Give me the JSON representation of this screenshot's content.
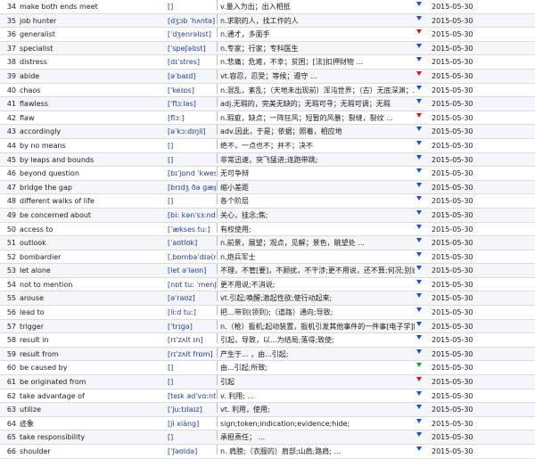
{
  "colors": {
    "flag_blue": "#1b4fd6",
    "flag_red": "#d11a1a",
    "flag_green": "#1d9a3a",
    "pron_text": "#1f3d9a"
  },
  "rows": [
    {
      "num": "34",
      "word": "make both ends meet",
      "pron": "[]",
      "def": "v.量入为出；出入相抵",
      "flag": "blue",
      "date": "2015-05-30"
    },
    {
      "num": "35",
      "word": "job hunter",
      "pron": "[dʒɔb ˈhʌntə]",
      "def": "n.求职的人，找工作的人",
      "flag": "blue",
      "date": "2015-05-30"
    },
    {
      "num": "36",
      "word": "generalist",
      "pron": "[ˈdʒenrəlɪst]",
      "def": "n.通才，多面手",
      "flag": "red",
      "date": "2015-05-30"
    },
    {
      "num": "37",
      "word": "specialist",
      "pron": "[ˈspeʃəlɪst]",
      "def": "n.专家；行家；专科医生",
      "flag": "blue",
      "date": "2015-05-30"
    },
    {
      "num": "38",
      "word": "distress",
      "pron": "[dɪˈstres]",
      "def": "n.悲痛；危难，不幸；贫困；[法]扣押财物 ...",
      "flag": "blue",
      "date": "2015-05-30"
    },
    {
      "num": "39",
      "word": "abide",
      "pron": "[əˈbaɪd]",
      "def": "vt.容忍，忍受；等候；遵守 ...",
      "flag": "red",
      "date": "2015-05-30"
    },
    {
      "num": "40",
      "word": "chaos",
      "pron": "[ˈkeɪɒs]",
      "def": "n.混乱，紊乱；（天地未出现前）浑沌世界；（古）无底深渊；...",
      "flag": "blue",
      "date": "2015-05-30"
    },
    {
      "num": "41",
      "word": "flawless",
      "pron": "[ˈflɔːləs]",
      "def": "adj.无瑕的，完美无缺的；无瑕可寻；无瑕可调；无瑕",
      "flag": "blue",
      "date": "2015-05-30"
    },
    {
      "num": "42",
      "word": "flaw",
      "pron": "[flɔː]",
      "def": "n.瑕疵，缺点；一阵狂风；短暂的风暴；裂缝，裂纹 ...",
      "flag": "red",
      "date": "2015-05-30"
    },
    {
      "num": "43",
      "word": "accordingly",
      "pron": "[əˈkɔːdɪŋli]",
      "def": "adv.因此，于是；依据；照着，相应地",
      "flag": "blue",
      "date": "2015-05-30"
    },
    {
      "num": "44",
      "word": "by no means",
      "pron": "[]",
      "def": "绝不，一点也不；并不；决不",
      "flag": "blue",
      "date": "2015-05-30"
    },
    {
      "num": "45",
      "word": "by leaps and bounds",
      "pron": "[]",
      "def": "非常迅速，突飞猛进;连跑带跳;",
      "flag": "blue",
      "date": "2015-05-30"
    },
    {
      "num": "46",
      "word": "beyond question",
      "pron": "[bɪˈjɒnd ˈkwest...",
      "def": "无可争辩",
      "flag": "blue",
      "date": "2015-05-30"
    },
    {
      "num": "47",
      "word": "bridge the gap",
      "pron": "[brɪdʒ ðə ɡæp]",
      "def": "缩小差距",
      "flag": "blue",
      "date": "2015-05-30"
    },
    {
      "num": "48",
      "word": "different walks of life",
      "pron": "[]",
      "def": "各个阶层",
      "flag": "blue",
      "date": "2015-05-30"
    },
    {
      "num": "49",
      "word": "be concerned about",
      "pron": "[bi: kənˈsɜːnd ...",
      "def": "关心，挂念;焦;",
      "flag": "blue",
      "date": "2015-05-30"
    },
    {
      "num": "50",
      "word": "access to",
      "pron": "[ˈækses tuː]",
      "def": "有权使用;",
      "flag": "blue",
      "date": "2015-05-30"
    },
    {
      "num": "51",
      "word": "outlook",
      "pron": "[ˈaʊtlʊk]",
      "def": "n.前景，展望；观点，见解；景色，眺望处 ...",
      "flag": "blue",
      "date": "2015-05-30"
    },
    {
      "num": "52",
      "word": "bombardier",
      "pron": "[ˌbɒmbəˈdɪə(r)]",
      "def": "n.炮兵军士",
      "flag": "blue",
      "date": "2015-05-30"
    },
    {
      "num": "53",
      "word": "let alone",
      "pron": "[let əˈləʊn]",
      "def": "不理，不管[要]，不顾扰，不干涉;更不用说，还不算;何况;别说;",
      "flag": "blue",
      "date": "2015-05-30"
    },
    {
      "num": "54",
      "word": "not to mention",
      "pron": "[nɒt tuː ˈmenʃən]",
      "def": "更不用说;不消说;",
      "flag": "blue",
      "date": "2015-05-30"
    },
    {
      "num": "55",
      "word": "arouse",
      "pron": "[əˈraʊz]",
      "def": "vt.引起;唤醒;激起性欲;使行动起来;",
      "flag": "blue",
      "date": "2015-05-30"
    },
    {
      "num": "56",
      "word": "lead to",
      "pron": "[liːd tuː]",
      "def": "把…带到(领到);（道路）通向;导致;",
      "flag": "blue",
      "date": "2015-05-30"
    },
    {
      "num": "57",
      "word": "trigger",
      "pron": "[ˈtrɪɡə]",
      "def": "n.（枪）扳机;起动装置，扳机引发其他事件的一件事[电子学]触...",
      "flag": "blue",
      "date": "2015-05-30"
    },
    {
      "num": "58",
      "word": "result in",
      "pron": "[rɪˈzʌlt ɪn]",
      "def": "引起，导致，以...为结局;落得;致使;",
      "flag": "blue",
      "date": "2015-05-30"
    },
    {
      "num": "59",
      "word": "result from",
      "pron": "[rɪˈzʌlt frɒm]",
      "def": "产生于... ，由...引起;",
      "flag": "blue",
      "date": "2015-05-30"
    },
    {
      "num": "60",
      "word": "be caused by",
      "pron": "[]",
      "def": "由...引起;所致;",
      "flag": "green",
      "date": "2015-05-30"
    },
    {
      "num": "61",
      "word": "be originated from",
      "pron": "[]",
      "def": "引起",
      "flag": "red",
      "date": "2015-05-30"
    },
    {
      "num": "62",
      "word": "take advantage of",
      "pron": "[teɪk ədˈvɑːntɪd...",
      "def": "v. 利用; ...",
      "flag": "blue",
      "date": "2015-05-30"
    },
    {
      "num": "63",
      "word": "utilize",
      "pron": "[ˈjuːtɪlaɪz]",
      "def": "vt. 利用，使用;",
      "flag": "blue",
      "date": "2015-05-30"
    },
    {
      "num": "64",
      "word": "迹象",
      "pron": "[jì xiàng]",
      "def": "sign;token;indication;evidence;hide;",
      "flag": "blue",
      "date": "2015-05-30"
    },
    {
      "num": "65",
      "word": "take responsibility",
      "pron": "[]",
      "def": "承担责任； ...",
      "flag": "blue",
      "date": "2015-05-30"
    },
    {
      "num": "66",
      "word": "shoulder",
      "pron": "[ˈʃəʊldə]",
      "def": "n. 肩膀;（衣服的）肩部;山肩;路肩; ...",
      "flag": "blue",
      "date": "2015-05-30"
    }
  ]
}
